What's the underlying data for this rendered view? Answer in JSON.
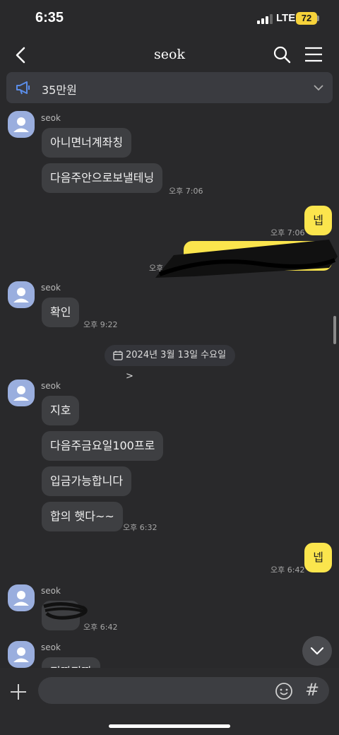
{
  "status_bar": {
    "time": "6:35",
    "network": "LTE",
    "battery": "72"
  },
  "header": {
    "title": "seok"
  },
  "notice": {
    "text": "35만원"
  },
  "date_divider": {
    "text": "2024년 3월 13일 수요일 >"
  },
  "messages": [
    {
      "sender": "seok",
      "text": "아니면너계좌칭"
    },
    {
      "text": "다음주안으로보낼테닝",
      "time": "오후 7:06"
    },
    {
      "text": "넵",
      "time": "오후 7:06"
    },
    {
      "time": "오후 7:07"
    },
    {
      "sender": "seok",
      "text": "확인",
      "time": "오후 9:22"
    },
    {
      "sender": "seok",
      "text": "지호"
    },
    {
      "text": "다음주금요일100프로"
    },
    {
      "text": "입금가능합니다"
    },
    {
      "text": "합의 햇다~~",
      "time": "오후 6:32"
    },
    {
      "text": "넵",
      "time": "오후 6:42"
    },
    {
      "sender": "seok",
      "time": "오후 6:42"
    },
    {
      "sender": "seok",
      "text": "진짜진짜"
    }
  ],
  "colors": {
    "background": "#29292b",
    "incoming_bubble": "#3e3f42",
    "outgoing_bubble": "#fbe54d",
    "avatar": "#9aaede"
  }
}
